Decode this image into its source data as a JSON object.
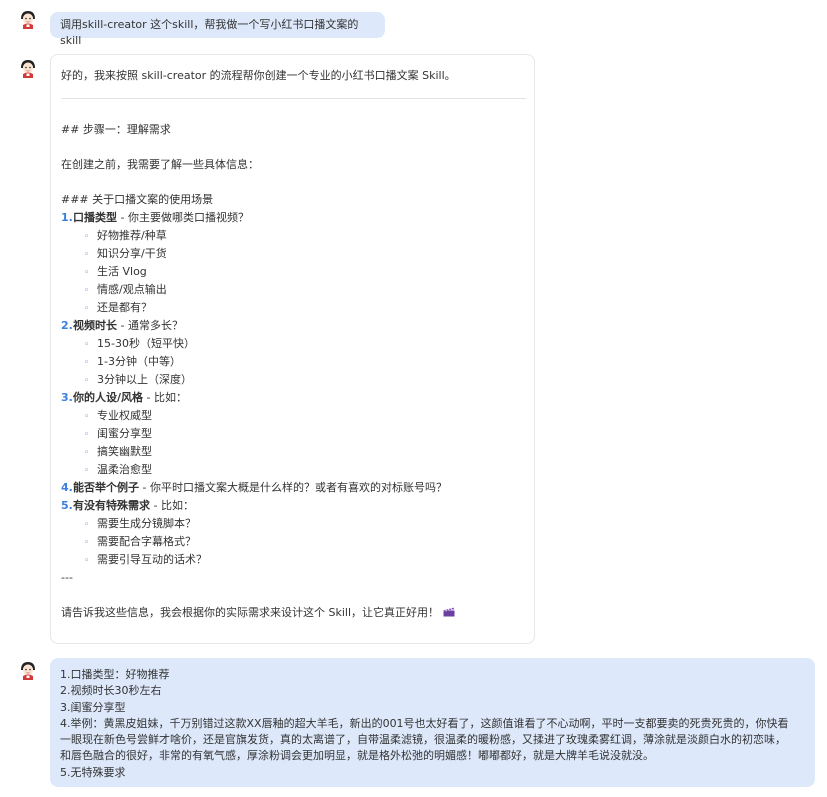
{
  "messages": {
    "user_1": {
      "text": "调用skill-creator 这个skill，帮我做一个写小红书口播文案的 skill"
    },
    "ai_1": {
      "intro": "好的，我来按照 skill-creator 的流程帮你创建一个专业的小红书口播文案 Skill。",
      "step_heading": "## 步骤一：理解需求",
      "before_text": "在创建之前，我需要了解一些具体信息：",
      "section_heading": "### 关于口播文案的使用场景",
      "questions": [
        {
          "num": "1.",
          "title": "口播类型",
          "desc": " - 你主要做哪类口播视频？",
          "options": [
            "好物推荐/种草",
            "知识分享/干货",
            "生活 Vlog",
            "情感/观点输出",
            "还是都有？"
          ]
        },
        {
          "num": "2.",
          "title": "视频时长",
          "desc": " - 通常多长？",
          "options": [
            "15-30秒（短平快）",
            "1-3分钟（中等）",
            "3分钟以上（深度）"
          ]
        },
        {
          "num": "3.",
          "title": "你的人设/风格",
          "desc": " - 比如：",
          "options": [
            "专业权威型",
            "闺蜜分享型",
            "搞笑幽默型",
            "温柔治愈型"
          ]
        },
        {
          "num": "4.",
          "title": "能否举个例子",
          "desc": " - 你平时口播文案大概是什么样的？或者有喜欢的对标账号吗？",
          "options": []
        },
        {
          "num": "5.",
          "title": "有没有特殊需求",
          "desc": " - 比如：",
          "options": [
            "需要生成分镜脚本？",
            "需要配合字幕格式？",
            "需要引导互动的话术？"
          ]
        }
      ],
      "separator": "---",
      "closing": "请告诉我这些信息，我会根据你的实际需求来设计这个 Skill，让它真正好用！"
    },
    "user_2": {
      "lines": [
        "1.口播类型：好物推荐",
        "2.视频时长30秒左右",
        "3.闺蜜分享型",
        "4.举例：黄黑皮姐妹，千万别错过这款XX唇釉的超大羊毛，新出的001号也太好看了，这颜值谁看了不心动啊，平时一支都要卖的死贵死贵的，你快看",
        "一眼现在新色号尝鲜才啥价，还是官旗发货，真的太离谱了，自带温柔滤镜，很温柔的暖粉感，又揉进了玫瑰柔雾红调，薄涂就是淡颜白水的初恋味，",
        "和唇色融合的很好，非常的有氧气感，厚涂粉调会更加明显，就是格外松弛的明媚感！嘟嘟都好，就是大牌羊毛说没就没。",
        "5.无特殊要求"
      ]
    }
  },
  "icons": {
    "avatar": "avatar-icon",
    "clapper": "clapper-board-icon",
    "bullet": "◦"
  }
}
